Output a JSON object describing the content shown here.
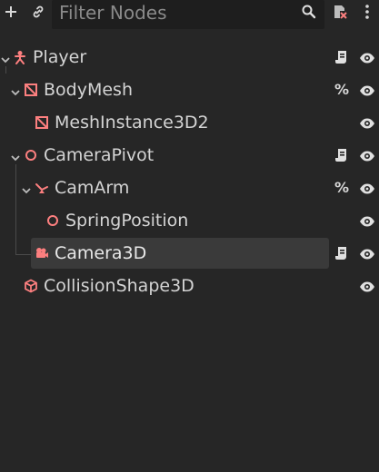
{
  "toolbar": {
    "add_icon": "plus-icon",
    "link_icon": "link-icon",
    "filter_placeholder": "Filter Nodes",
    "search_icon": "search-icon",
    "scene_filter_icon": "scene-filter-icon",
    "menu_icon": "kebab-menu-icon"
  },
  "colors": {
    "background": "#262626",
    "node_3d": "#fc7f7f",
    "text": "#d4d4d4",
    "selected": "#3a3a3a"
  },
  "tree": {
    "nodes": [
      {
        "label": "Player",
        "icon": "character-body-icon",
        "expanded": true,
        "script": true,
        "percent": "",
        "visible": true
      },
      {
        "label": "BodyMesh",
        "icon": "node3d-icon",
        "expanded": true,
        "script": false,
        "percent": "%",
        "visible": true
      },
      {
        "label": "MeshInstance3D2",
        "icon": "mesh-instance-icon",
        "expanded": false,
        "script": false,
        "percent": "",
        "visible": true
      },
      {
        "label": "CameraPivot",
        "icon": "marker-icon",
        "expanded": true,
        "script": true,
        "percent": "",
        "visible": true
      },
      {
        "label": "CamArm",
        "icon": "spring-arm-icon",
        "expanded": true,
        "script": false,
        "percent": "%",
        "visible": true
      },
      {
        "label": "SpringPosition",
        "icon": "marker-icon",
        "expanded": false,
        "script": false,
        "percent": "",
        "visible": true
      },
      {
        "label": "Camera3D",
        "icon": "camera-icon",
        "expanded": false,
        "script": true,
        "percent": "",
        "visible": true,
        "selected": true
      },
      {
        "label": "CollisionShape3D",
        "icon": "collision-shape-icon",
        "expanded": false,
        "script": false,
        "percent": "",
        "visible": true
      }
    ]
  }
}
